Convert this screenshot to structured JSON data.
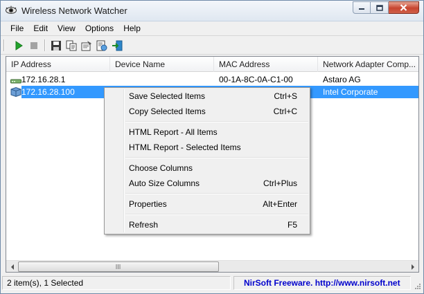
{
  "window": {
    "title": "Wireless Network Watcher",
    "icon": "eye-icon"
  },
  "menu": {
    "items": [
      "File",
      "Edit",
      "View",
      "Options",
      "Help"
    ]
  },
  "toolbar": {
    "buttons": [
      "play-icon",
      "stop-icon",
      "save-icon",
      "copy-icon",
      "properties-icon",
      "html-report-icon",
      "exit-icon"
    ]
  },
  "list": {
    "columns": [
      "IP Address",
      "Device Name",
      "MAC Address",
      "Network Adapter Comp..."
    ],
    "rows": [
      {
        "ip": "172.16.28.1",
        "device": "",
        "mac": "00-1A-8C-0A-C1-00",
        "vendor": "Astaro AG",
        "icon": "router-icon",
        "selected": false
      },
      {
        "ip": "172.16.28.100",
        "device": "",
        "mac": "",
        "vendor": "Intel Corporate",
        "icon": "computer-icon",
        "selected": true
      }
    ]
  },
  "context_menu": {
    "items": [
      {
        "label": "Save Selected Items",
        "shortcut": "Ctrl+S"
      },
      {
        "label": "Copy Selected Items",
        "shortcut": "Ctrl+C"
      },
      {
        "label": "HTML Report - All Items",
        "shortcut": ""
      },
      {
        "label": "HTML Report - Selected Items",
        "shortcut": ""
      },
      {
        "label": "Choose Columns",
        "shortcut": ""
      },
      {
        "label": "Auto Size Columns",
        "shortcut": "Ctrl+Plus"
      },
      {
        "label": "Properties",
        "shortcut": "Alt+Enter"
      },
      {
        "label": "Refresh",
        "shortcut": "F5"
      }
    ]
  },
  "status": {
    "count": "2 item(s), 1 Selected",
    "credit": "NirSoft Freeware.  http://www.nirsoft.net"
  },
  "colors": {
    "selection": "#3399ff",
    "link": "#0000cc",
    "close_button": "#c7452f"
  }
}
